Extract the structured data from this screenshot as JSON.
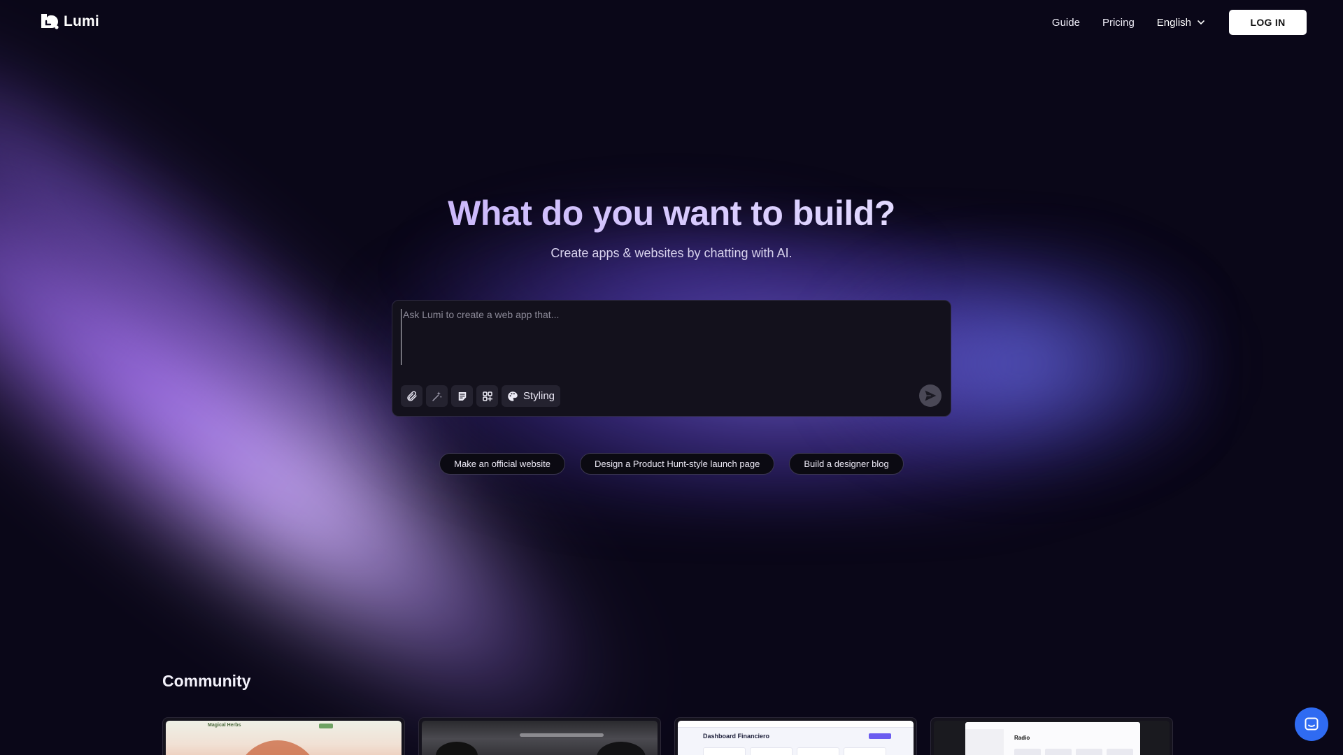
{
  "brand": {
    "name": "Lumi"
  },
  "nav": {
    "links": [
      "Guide",
      "Pricing"
    ],
    "language": "English",
    "login_label": "LOG IN"
  },
  "hero": {
    "title": "What do you want to build?",
    "subtitle": "Create apps & websites by chatting with AI."
  },
  "prompt": {
    "placeholder": "Ask Lumi to create a web app that...",
    "tools": [
      "attach-icon",
      "magic-wand-icon",
      "notes-icon",
      "components-icon"
    ],
    "styling_label": "Styling"
  },
  "suggestions": [
    "Make an official website",
    "Design a Product Hunt-style launch page",
    "Build a designer blog"
  ],
  "community": {
    "title": "Community",
    "cards": [
      {
        "label": "Magical Herbs"
      },
      {
        "label": ""
      },
      {
        "label": "Dashboard Financiero"
      },
      {
        "label": "Radio"
      }
    ]
  },
  "colors": {
    "accent_purple": "#a98cf5",
    "background": "#0a0718",
    "chat_button": "#2f6bf2"
  }
}
